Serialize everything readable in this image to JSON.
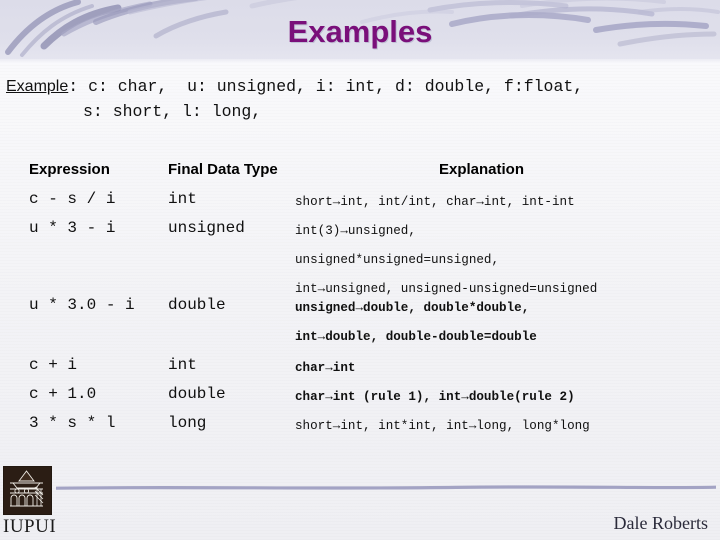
{
  "slide": {
    "title": "Examples",
    "title_color": "#7a0f7a",
    "band_color": "#dcdce9",
    "background_color": "#f4f4f6",
    "accent_line_color": "#a3a3c4"
  },
  "example_block": {
    "label": "Example",
    "label_suffix": ":",
    "line1": "c: char,  u: unsigned, i: int, d: double, f:float,",
    "line2": "s: short, l: long,"
  },
  "table": {
    "headers": {
      "expression": "Expression",
      "final_data_type": "Final Data Type",
      "explanation": "Explanation"
    },
    "rows": [
      {
        "expression": "c - s / i",
        "type": "int",
        "explanation_lines": [
          {
            "text": "short→int, int/int, char→int, int-int",
            "bold": false
          }
        ]
      },
      {
        "expression": "u * 3 - i",
        "type": "unsigned",
        "explanation_lines": [
          {
            "text": "int(3)→unsigned,",
            "bold": false
          },
          {
            "text": "unsigned*unsigned=unsigned,",
            "bold": false
          },
          {
            "text": "int→unsigned, unsigned-unsigned=unsigned",
            "bold": false
          }
        ]
      },
      {
        "expression": "u * 3.0 - i",
        "type": "double",
        "explanation_lines": [
          {
            "text": "unsigned→double, double*double,",
            "bold": true
          },
          {
            "text": "int→double, double-double=double",
            "bold": true
          }
        ]
      },
      {
        "expression": "c + i",
        "type": "int",
        "explanation_lines": [
          {
            "text": "char→int",
            "bold": true
          }
        ]
      },
      {
        "expression": "c + 1.0",
        "type": "double",
        "explanation_lines": [
          {
            "text": "char→int (rule 1), int→double(rule 2)",
            "bold": true
          }
        ]
      },
      {
        "expression": "3 * s * l",
        "type": "long",
        "explanation_lines": [
          {
            "text": "short→int, int*int, int→long, long*long",
            "bold": false
          }
        ]
      }
    ]
  },
  "footer": {
    "logo_text": "IUPUI",
    "author": "Dale Roberts"
  }
}
